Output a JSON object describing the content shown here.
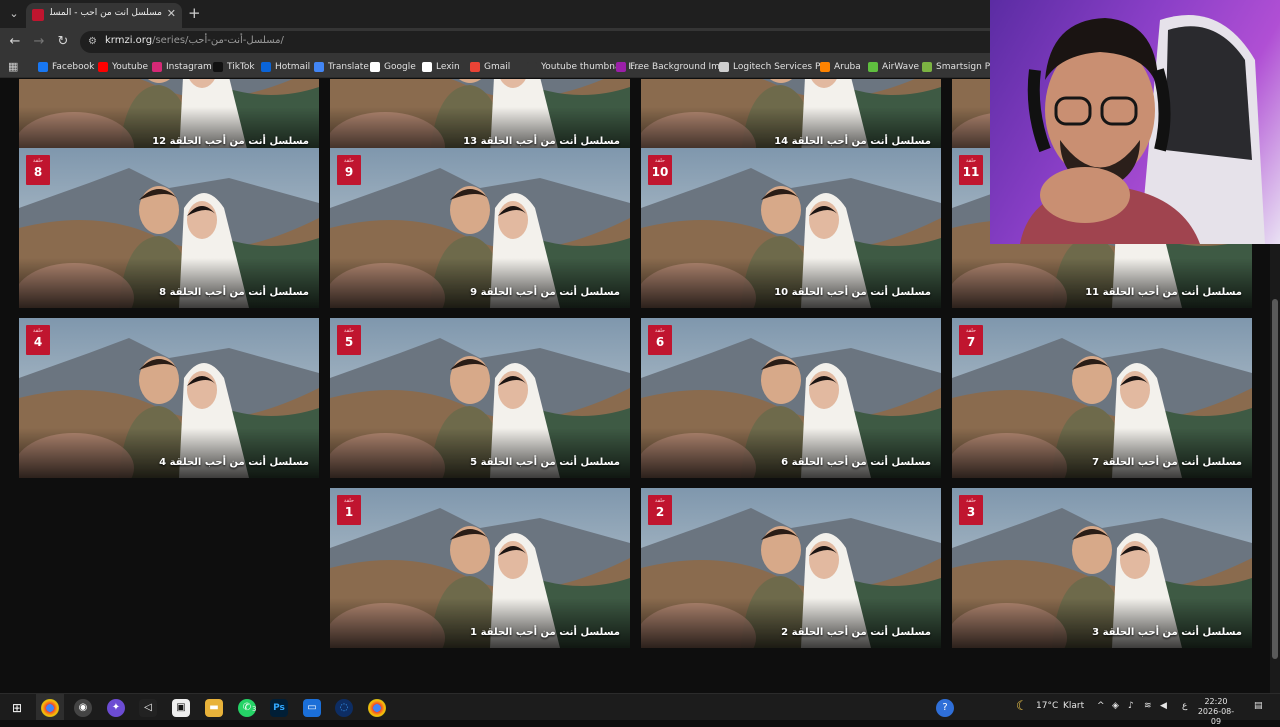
{
  "tab": {
    "title": "مسلسل أنت من أحب - المسلسلا"
  },
  "address": {
    "host": "krmzi.org",
    "path": "/series/مسلسل-أنت-من-أحب/"
  },
  "bookmarks": [
    {
      "label": "Facebook",
      "color": "#1877f2"
    },
    {
      "label": "Youtube",
      "color": "#ff0000"
    },
    {
      "label": "Instagram",
      "color": "#d62976"
    },
    {
      "label": "TikTok",
      "color": "#111111"
    },
    {
      "label": "Hotmail",
      "color": "#0a64d8"
    },
    {
      "label": "Translate",
      "color": "#4285f4"
    },
    {
      "label": "Google",
      "color": "#ffffff"
    },
    {
      "label": "Lexin",
      "color": "#ffffff"
    },
    {
      "label": "Gmail",
      "color": "#ea4335"
    },
    {
      "label": "Youtube thumbnail I...",
      "color": "#353535"
    },
    {
      "label": "Free Background Im...",
      "color": "#9b1fa8"
    },
    {
      "label": "Logitech Services P...",
      "color": "#cfcfcf"
    },
    {
      "label": "Aruba",
      "color": "#ff8300"
    },
    {
      "label": "AirWave",
      "color": "#5fbf3f"
    },
    {
      "label": "Smartsign Publ",
      "color": "#7cb342"
    }
  ],
  "episode_badge_label": "حلقة",
  "episodes": [
    {
      "number": "12",
      "title": "مسلسل أنت من أحب الحلقة 12"
    },
    {
      "number": "13",
      "title": "مسلسل أنت من أحب الحلقة 13"
    },
    {
      "number": "14",
      "title": "مسلسل أنت من أحب الحلقة 14"
    },
    {
      "number": "",
      "title": ""
    },
    {
      "number": "8",
      "title": "مسلسل أنت من أحب الحلقة 8"
    },
    {
      "number": "9",
      "title": "مسلسل أنت من أحب الحلقة 9"
    },
    {
      "number": "10",
      "title": "مسلسل أنت من أحب الحلقة 10"
    },
    {
      "number": "11",
      "title": "مسلسل أنت من أحب الحلقة 11"
    },
    {
      "number": "4",
      "title": "مسلسل أنت من أحب الحلقة 4"
    },
    {
      "number": "5",
      "title": "مسلسل أنت من أحب الحلقة 5"
    },
    {
      "number": "6",
      "title": "مسلسل أنت من أحب الحلقة 6"
    },
    {
      "number": "7",
      "title": "مسلسل أنت من أحب الحلقة 7"
    },
    {
      "number": "1",
      "title": "مسلسل أنت من أحب الحلقة 1"
    },
    {
      "number": "2",
      "title": "مسلسل أنت من أحب الحلقة 2"
    },
    {
      "number": "3",
      "title": "مسلسل أنت من أحب الحلقة 3"
    }
  ],
  "taskbar": {
    "weather_temp": "17°C",
    "weather_text": "Klart",
    "lang": "ع",
    "time": "22:20",
    "date": "2026-08-09",
    "whatsapp_badge": "3"
  },
  "colors": {
    "accent": "#c0152f",
    "background": "#0e0e0e"
  }
}
